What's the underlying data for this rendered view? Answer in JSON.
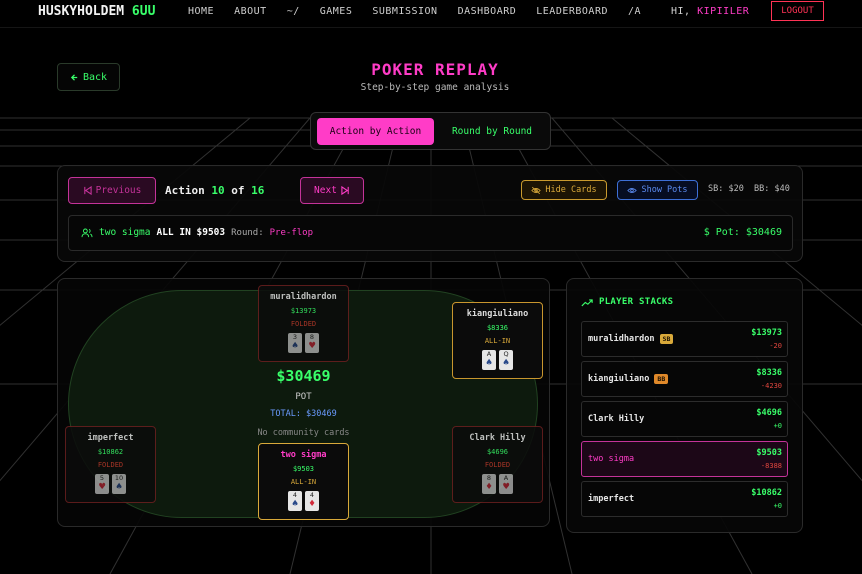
{
  "nav": {
    "logo_main": "HUSKYHOLDEM",
    "logo_tag": "6UU",
    "links": [
      "HOME",
      "ABOUT",
      "~/",
      "GAMES",
      "SUBMISSION",
      "DASHBOARD",
      "LEADERBOARD",
      "/A"
    ],
    "greeting": "HI,",
    "username": "KIPIILER",
    "logout_label": "LOGOUT"
  },
  "header": {
    "back_label": "Back",
    "title": "POKER REPLAY",
    "subtitle": "Step-by-step game analysis"
  },
  "toggle": {
    "active_label": "Action by Action",
    "inactive_label": "Round by Round"
  },
  "controls": {
    "prev_label": "Previous",
    "action_word": "Action",
    "action_current": "10",
    "of_word": "of",
    "action_total": "16",
    "next_label": "Next",
    "hide_cards_label": "Hide Cards",
    "show_pots_label": "Show Pots",
    "blinds": "SB: $20  BB: $40"
  },
  "current_action": {
    "player": "two sigma",
    "action": "ALL IN $9503",
    "round_label": "Round:",
    "round": "Pre-flop",
    "pot": "Pot: $30469"
  },
  "table": {
    "pot_amount": "$30469",
    "pot_label": "POT",
    "total": "TOTAL: $30469",
    "community": "No community cards",
    "seats": [
      {
        "name": "muralidhardon",
        "stack": "$13973",
        "status": "FOLDED",
        "cards": [
          {
            "rank": "3",
            "suit": "♠"
          },
          {
            "rank": "8",
            "suit": "♥"
          }
        ]
      },
      {
        "name": "kiangiuliano",
        "stack": "$8336",
        "status": "ALL-IN",
        "cards": [
          {
            "rank": "A",
            "suit": "♠"
          },
          {
            "rank": "Q",
            "suit": "♠"
          }
        ]
      },
      {
        "name": "imperfect",
        "stack": "$10862",
        "status": "FOLDED",
        "cards": [
          {
            "rank": "5",
            "suit": "♥"
          },
          {
            "rank": "10",
            "suit": "♠"
          }
        ]
      },
      {
        "name": "two sigma",
        "stack": "$9503",
        "status": "ALL-IN",
        "cards": [
          {
            "rank": "4",
            "suit": "♠"
          },
          {
            "rank": "4",
            "suit": "♦"
          }
        ]
      },
      {
        "name": "Clark Hilly",
        "stack": "$4696",
        "status": "FOLDED",
        "cards": [
          {
            "rank": "8",
            "suit": "♦"
          },
          {
            "rank": "A",
            "suit": "♥"
          }
        ]
      }
    ]
  },
  "stacks": {
    "title": "PLAYER STACKS",
    "rows": [
      {
        "name": "muralidhardon",
        "badge": "SB",
        "amount": "$13973",
        "delta": "-20"
      },
      {
        "name": "kiangiuliano",
        "badge": "BB",
        "amount": "$8336",
        "delta": "-4230"
      },
      {
        "name": "Clark Hilly",
        "badge": "",
        "amount": "$4696",
        "delta": "+0"
      },
      {
        "name": "two sigma",
        "badge": "",
        "amount": "$9503",
        "delta": "-8388"
      },
      {
        "name": "imperfect",
        "badge": "",
        "amount": "$10862",
        "delta": "+0"
      }
    ]
  },
  "colors": {
    "accent_pink": "#ff3cc7",
    "accent_green": "#39ff6a",
    "gold": "#d9a93a",
    "blue": "#5b8bf0",
    "red": "#e0463e"
  }
}
